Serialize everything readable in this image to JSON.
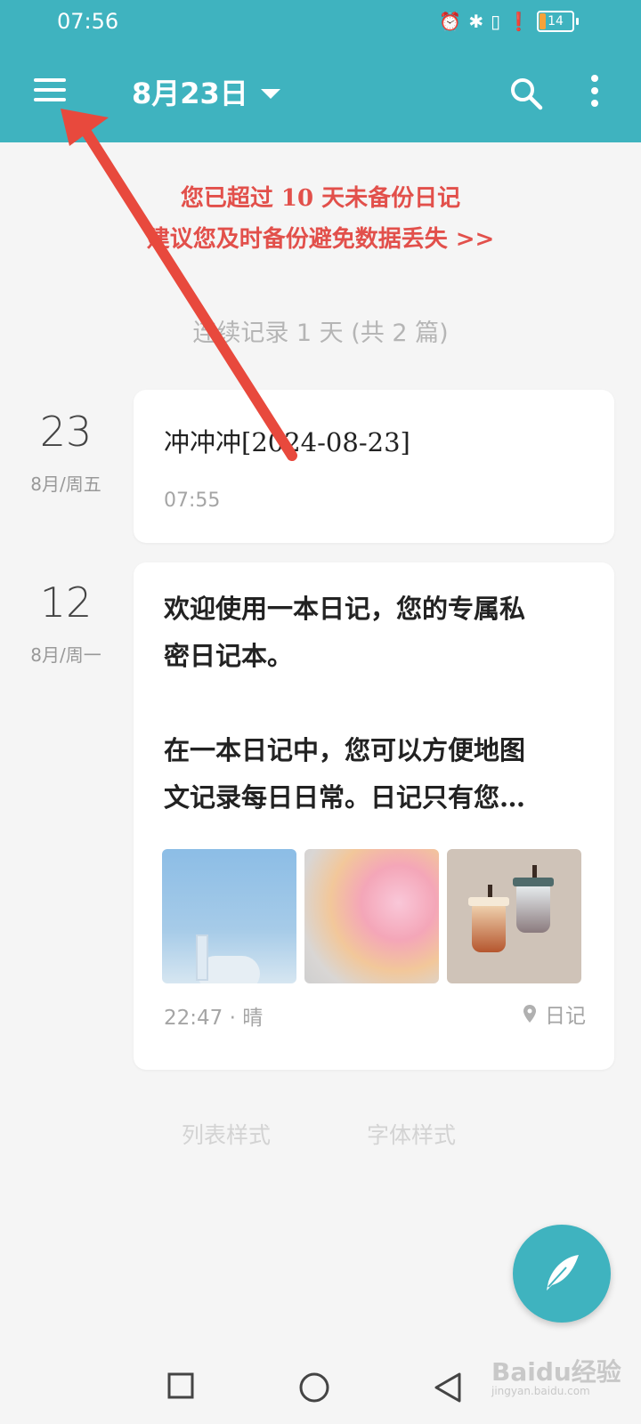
{
  "status_bar": {
    "time": "07:56",
    "battery": "14"
  },
  "header": {
    "title": "8月23日"
  },
  "warning": {
    "line1": "您已超过 10 天未备份日记",
    "line2": "建议您及时备份避免数据丢失 >>"
  },
  "streak": "连续记录 1 天 (共 2 篇)",
  "entries": [
    {
      "day": "23",
      "month_weekday": "8月/周五",
      "title": "冲冲冲[2024-08-23]",
      "time": "07:55"
    },
    {
      "day": "12",
      "month_weekday": "8月/周一",
      "para1_line1": "欢迎使用一本日记，您的专属私",
      "para1_line2": "密日记本。",
      "para2_line1": "在一本日记中，您可以方便地图",
      "para2_line2": "文记录每日日常。日记只有您…",
      "footer": "22:47 · 晴",
      "tag": "日记",
      "image_icons": [
        "sky-photo",
        "abstract-gradient-photo",
        "bubble-tea-illustration"
      ]
    }
  ],
  "bottom_links": {
    "list_style": "列表样式",
    "font_style": "字体样式"
  },
  "watermark": {
    "brand": "Baidu经验",
    "sub": "jingyan.baidu.com"
  },
  "colors": {
    "accent": "#3fb3bf",
    "warning": "#e2504b",
    "annotation": "#e8493d"
  }
}
